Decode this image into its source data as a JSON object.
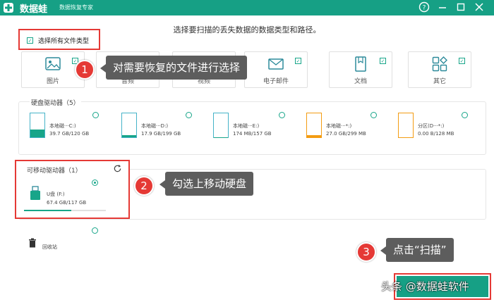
{
  "titlebar": {
    "brand": "数据蛙",
    "subtitle": "数据恢复专家",
    "help_icon": "help-icon",
    "minimize_icon": "minimize-icon",
    "close_icon": "close-icon",
    "color": "#16a085"
  },
  "instruction": "选择要扫描的丢失数据的数据类型和路径。",
  "select_all_label": "选择所有文件类型",
  "file_types": [
    {
      "label": "图片",
      "icon": "image-icon",
      "checked": true
    },
    {
      "label": "音频",
      "icon": "audio-icon",
      "checked": true
    },
    {
      "label": "视频",
      "icon": "video-icon",
      "checked": true
    },
    {
      "label": "电子邮件",
      "icon": "email-icon",
      "checked": true
    },
    {
      "label": "文档",
      "icon": "document-icon",
      "checked": true
    },
    {
      "label": "其它",
      "icon": "other-icon",
      "checked": true
    }
  ],
  "hard_drives": {
    "title": "硬盘驱动器（5）",
    "drives": [
      {
        "name": "本地磁···C:)",
        "size": "39.7 GB/120 GB",
        "fill_fraction": 0.33,
        "fill_color": "#17a589"
      },
      {
        "name": "本地磁···D:)",
        "size": "17.9 GB/199 GB",
        "fill_fraction": 0.09,
        "fill_color": "#17a589"
      },
      {
        "name": "本地磁···E:)",
        "size": "174 MB/157 GB",
        "fill_fraction": 0.01,
        "fill_color": "#17a589"
      },
      {
        "name": "本地磁···*:)",
        "size": "27.0 GB/299 MB",
        "fill_fraction": 0.1,
        "fill_color": "#f39c12"
      },
      {
        "name": "分区(D···*:)",
        "size": "0.00  B/128 MB",
        "fill_fraction": 0.0,
        "fill_color": "#f39c12"
      }
    ]
  },
  "removable": {
    "title": "可移动驱动器（1）",
    "refresh_icon": "refresh-icon",
    "drive_name": "U盘 (F:)",
    "drive_size": "67.4 GB/117 GB",
    "usage_fraction": 0.58
  },
  "recycle_bin": {
    "label": "回收站",
    "icon": "trash-icon"
  },
  "callouts": [
    {
      "number": "1",
      "text": "对需要恢复的文件进行选择"
    },
    {
      "number": "2",
      "text": "勾选上移动硬盘"
    },
    {
      "number": "3",
      "text": "点击“扫描”"
    }
  ],
  "watermark": "头条 @数据蛙软件"
}
